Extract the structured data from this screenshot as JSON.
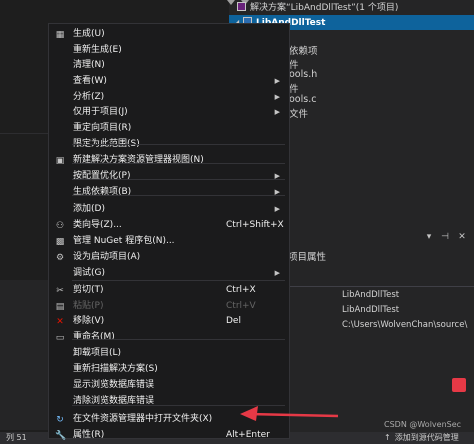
{
  "solution_explorer": {
    "solution_label": "解决方案“LibAndDllTest”(1 个项目)",
    "project_label": "LibAndDllTest",
    "tree_fragments": [
      "依赖项",
      "件",
      "ools.h",
      "件",
      "ools.c",
      "文件"
    ]
  },
  "properties": {
    "title_fragment": "项目属性",
    "rows": [
      {
        "value": "LibAndDllTest"
      },
      {
        "value": "LibAndDllTest"
      },
      {
        "value": "C:\\Users\\WolvenChan\\source\\"
      }
    ]
  },
  "status_bar": {
    "left_text": "列 51",
    "right_text": "添加到源代码管理",
    "watermark": "CSDN @WolvenSec"
  },
  "context_menu": {
    "items": [
      {
        "icon": "build-icon",
        "glyph": "▦",
        "label": "生成(U)",
        "shortcut": "",
        "submenu": false,
        "disabled": false
      },
      {
        "icon": "",
        "glyph": "",
        "label": "重新生成(E)",
        "shortcut": "",
        "submenu": false,
        "disabled": false
      },
      {
        "icon": "",
        "glyph": "",
        "label": "清理(N)",
        "shortcut": "",
        "submenu": false,
        "disabled": false
      },
      {
        "icon": "",
        "glyph": "",
        "label": "查看(W)",
        "shortcut": "",
        "submenu": true,
        "disabled": false
      },
      {
        "icon": "",
        "glyph": "",
        "label": "分析(Z)",
        "shortcut": "",
        "submenu": true,
        "disabled": false
      },
      {
        "icon": "",
        "glyph": "",
        "label": "仅用于项目(J)",
        "shortcut": "",
        "submenu": true,
        "disabled": false
      },
      {
        "icon": "",
        "glyph": "",
        "label": "重定向项目(R)",
        "shortcut": "",
        "submenu": false,
        "disabled": false
      },
      {
        "icon": "",
        "glyph": "",
        "label": "限定为此范围(S)",
        "shortcut": "",
        "submenu": false,
        "disabled": false
      },
      {
        "icon": "new-explorer-view-icon",
        "glyph": "▣",
        "label": "新建解决方案资源管理器视图(N)",
        "shortcut": "",
        "submenu": false,
        "disabled": false
      },
      {
        "icon": "",
        "glyph": "",
        "label": "按配置优化(P)",
        "shortcut": "",
        "submenu": true,
        "disabled": false
      },
      {
        "icon": "",
        "glyph": "",
        "label": "生成依赖项(B)",
        "shortcut": "",
        "submenu": true,
        "disabled": false
      },
      {
        "icon": "",
        "glyph": "",
        "label": "添加(D)",
        "shortcut": "",
        "submenu": true,
        "disabled": false
      },
      {
        "icon": "class-wizard-icon",
        "glyph": "⚇",
        "label": "类向导(Z)...",
        "shortcut": "Ctrl+Shift+X",
        "submenu": false,
        "disabled": false
      },
      {
        "icon": "nuget-icon",
        "glyph": "▩",
        "label": "管理 NuGet 程序包(N)...",
        "shortcut": "",
        "submenu": false,
        "disabled": false
      },
      {
        "icon": "gear-icon",
        "glyph": "⚙",
        "label": "设为启动项目(A)",
        "shortcut": "",
        "submenu": false,
        "disabled": false
      },
      {
        "icon": "",
        "glyph": "",
        "label": "调试(G)",
        "shortcut": "",
        "submenu": true,
        "disabled": false
      },
      {
        "icon": "cut-icon",
        "glyph": "✂",
        "label": "剪切(T)",
        "shortcut": "Ctrl+X",
        "submenu": false,
        "disabled": false
      },
      {
        "icon": "paste-icon",
        "glyph": "▤",
        "label": "粘贴(P)",
        "shortcut": "Ctrl+V",
        "submenu": false,
        "disabled": true
      },
      {
        "icon": "remove-icon",
        "glyph": "✕",
        "label": "移除(V)",
        "shortcut": "Del",
        "submenu": false,
        "disabled": false
      },
      {
        "icon": "rename-icon",
        "glyph": "▭",
        "label": "重命名(M)",
        "shortcut": "",
        "submenu": false,
        "disabled": false
      },
      {
        "icon": "",
        "glyph": "",
        "label": "卸载项目(L)",
        "shortcut": "",
        "submenu": false,
        "disabled": false
      },
      {
        "icon": "",
        "glyph": "",
        "label": "重新扫描解决方案(S)",
        "shortcut": "",
        "submenu": false,
        "disabled": false
      },
      {
        "icon": "",
        "glyph": "",
        "label": "显示浏览数据库错误",
        "shortcut": "",
        "submenu": false,
        "disabled": false
      },
      {
        "icon": "",
        "glyph": "",
        "label": "清除浏览数据库错误",
        "shortcut": "",
        "submenu": false,
        "disabled": false
      },
      {
        "icon": "open-folder-icon",
        "glyph": "↻",
        "label": "在文件资源管理器中打开文件夹(X)",
        "shortcut": "",
        "submenu": false,
        "disabled": false
      },
      {
        "icon": "properties-icon",
        "glyph": "🔧",
        "label": "属性(R)",
        "shortcut": "Alt+Enter",
        "submenu": false,
        "disabled": false
      }
    ]
  },
  "colors": {
    "menu_bg": "#1b1b1c",
    "selection": "#0e639c",
    "annotation_arrow": "#e63946",
    "remove_icon": "#e51400"
  }
}
